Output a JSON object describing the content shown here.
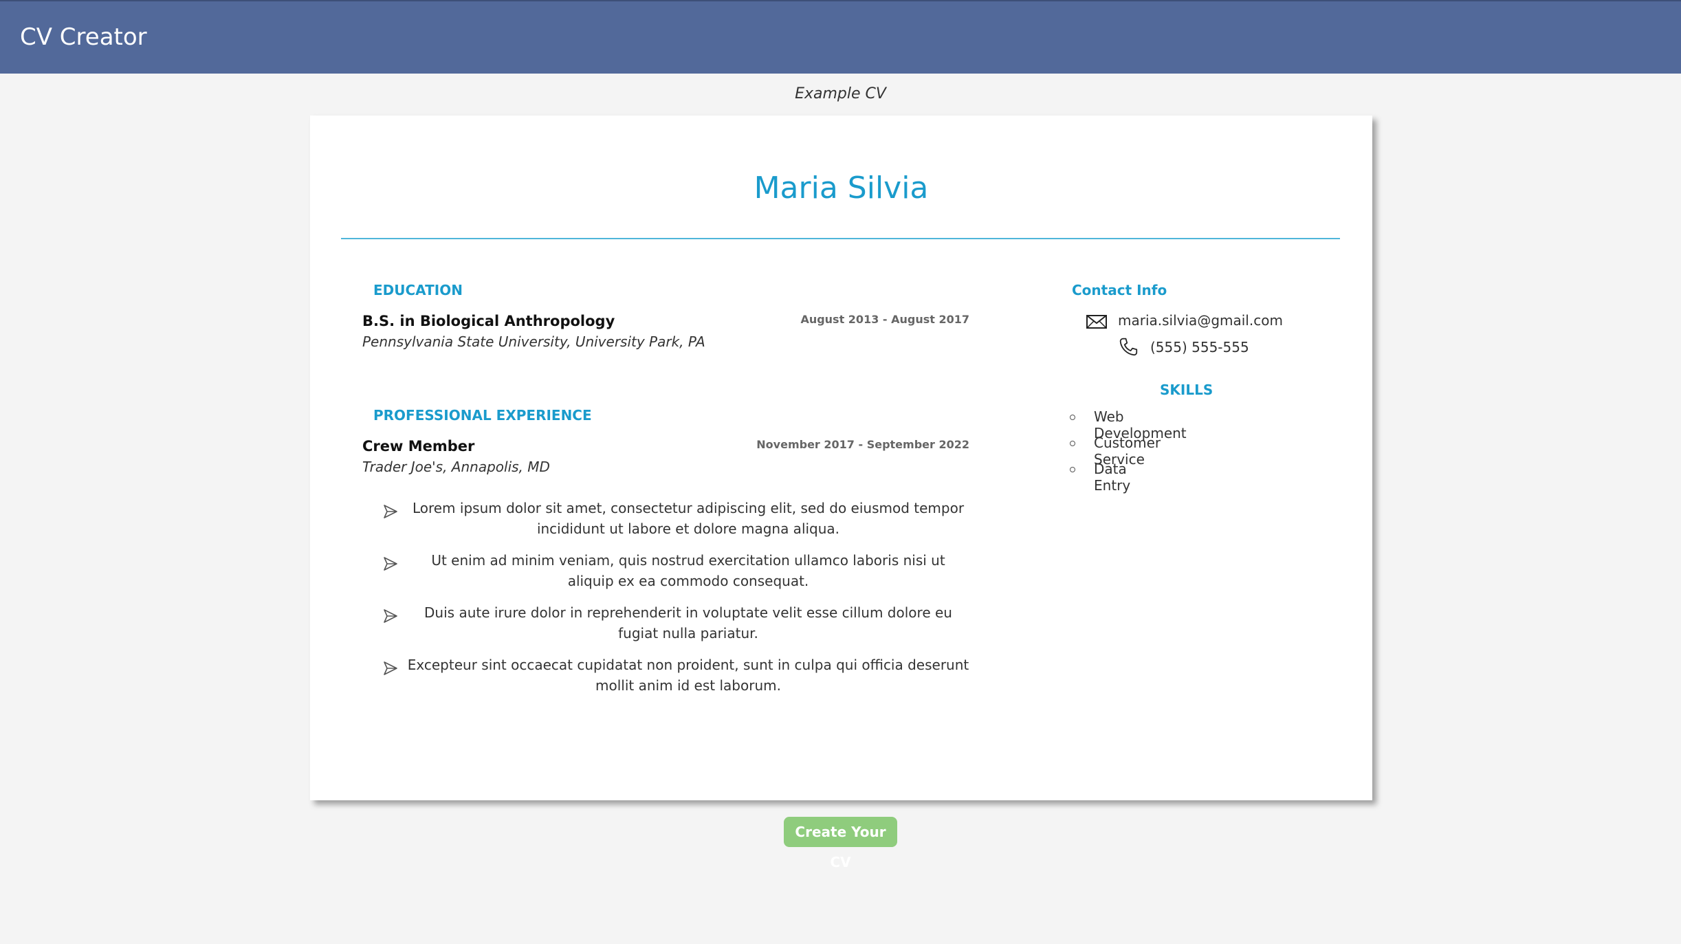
{
  "app": {
    "title": "CV Creator"
  },
  "caption": "Example CV",
  "cv": {
    "name": "Maria Silvia",
    "education": {
      "heading": "EDUCATION",
      "degree": "B.S. in Biological Anthropology",
      "school": "Pennsylvania State University, University Park, PA",
      "dates": "August 2013 - August 2017"
    },
    "experience": {
      "heading": "PROFESSIONAL EXPERIENCE",
      "role": "Crew Member",
      "company": "Trader Joe's, Annapolis, MD",
      "dates": "November 2017 - September 2022",
      "bullets": [
        {
          "text": "Lorem ipsum dolor sit amet, consectetur adipiscing elit, sed do eiusmod tempor incididunt ut labore et dolore magna aliqua."
        },
        {
          "text": "Ut enim ad minim veniam, quis nostrud exercitation ullamco laboris nisi ut aliquip ex ea commodo consequat."
        },
        {
          "text": "Duis aute irure dolor in reprehenderit in voluptate velit esse cillum dolore eu fugiat nulla pariatur."
        },
        {
          "text": "Excepteur sint occaecat cupidatat non proident, sunt in culpa qui officia deserunt mollit anim id est laborum."
        }
      ],
      "bullet_icon": "send-arrow-icon"
    },
    "contact": {
      "heading": "Contact Info",
      "email": "maria.silvia@gmail.com",
      "phone": "(555) 555-555",
      "email_icon": "envelope-icon",
      "phone_icon": "phone-icon"
    },
    "skills": {
      "heading": "SKILLS",
      "items": [
        "Web Development",
        "Customer Service",
        "Data Entry"
      ]
    }
  },
  "actions": {
    "create_label": "Create Your CV"
  },
  "colors": {
    "header_bg": "#52699a",
    "accent": "#1a9bcc",
    "button_bg": "#8fcc7d",
    "page_bg": "#f4f4f4"
  }
}
